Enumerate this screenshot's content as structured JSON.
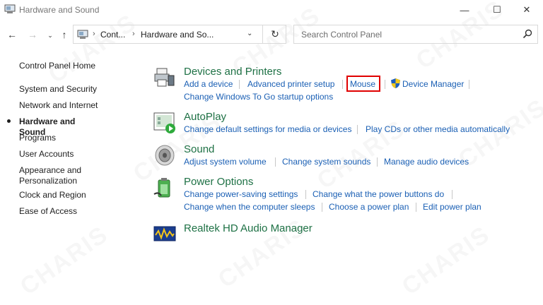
{
  "window": {
    "title": "Hardware and Sound",
    "minimize_glyph": "—",
    "maximize_glyph": "☐",
    "close_glyph": "✕"
  },
  "nav": {
    "back_glyph": "←",
    "forward_glyph": "→",
    "recent_glyph": "⌄",
    "up_glyph": "↑",
    "breadcrumb": [
      "Cont...",
      "Hardware and So..."
    ],
    "separator_glyph": "›",
    "dropdown_glyph": "⌄",
    "refresh_glyph": "↻",
    "search_placeholder": "Search Control Panel"
  },
  "sidebar": {
    "items": [
      {
        "label": "Control Panel Home"
      },
      {
        "label": "System and Security"
      },
      {
        "label": "Network and Internet"
      },
      {
        "label": "Hardware and Sound",
        "active": true
      },
      {
        "label": "Programs"
      },
      {
        "label": "User Accounts"
      },
      {
        "label": "Appearance and Personalization"
      },
      {
        "label": "Clock and Region"
      },
      {
        "label": "Ease of Access"
      }
    ]
  },
  "categories": {
    "devices": {
      "title": "Devices and Printers",
      "links": [
        "Add a device",
        "Advanced printer setup",
        "Mouse",
        "Device Manager",
        "Change Windows To Go startup options"
      ],
      "highlighted": "Mouse"
    },
    "autoplay": {
      "title": "AutoPlay",
      "links": [
        "Change default settings for media or devices",
        "Play CDs or other media automatically"
      ]
    },
    "sound": {
      "title": "Sound",
      "links": [
        "Adjust system volume",
        "Change system sounds",
        "Manage audio devices"
      ]
    },
    "power": {
      "title": "Power Options",
      "links": [
        "Change power-saving settings",
        "Change what the power buttons do",
        "Change when the computer sleeps",
        "Choose a power plan",
        "Edit power plan"
      ]
    },
    "realtek": {
      "title": "Realtek HD Audio Manager"
    }
  },
  "watermark": "CHARIS",
  "colors": {
    "category_title": "#1e7145",
    "link": "#1a5fb4",
    "highlight_box": "#e00000"
  }
}
